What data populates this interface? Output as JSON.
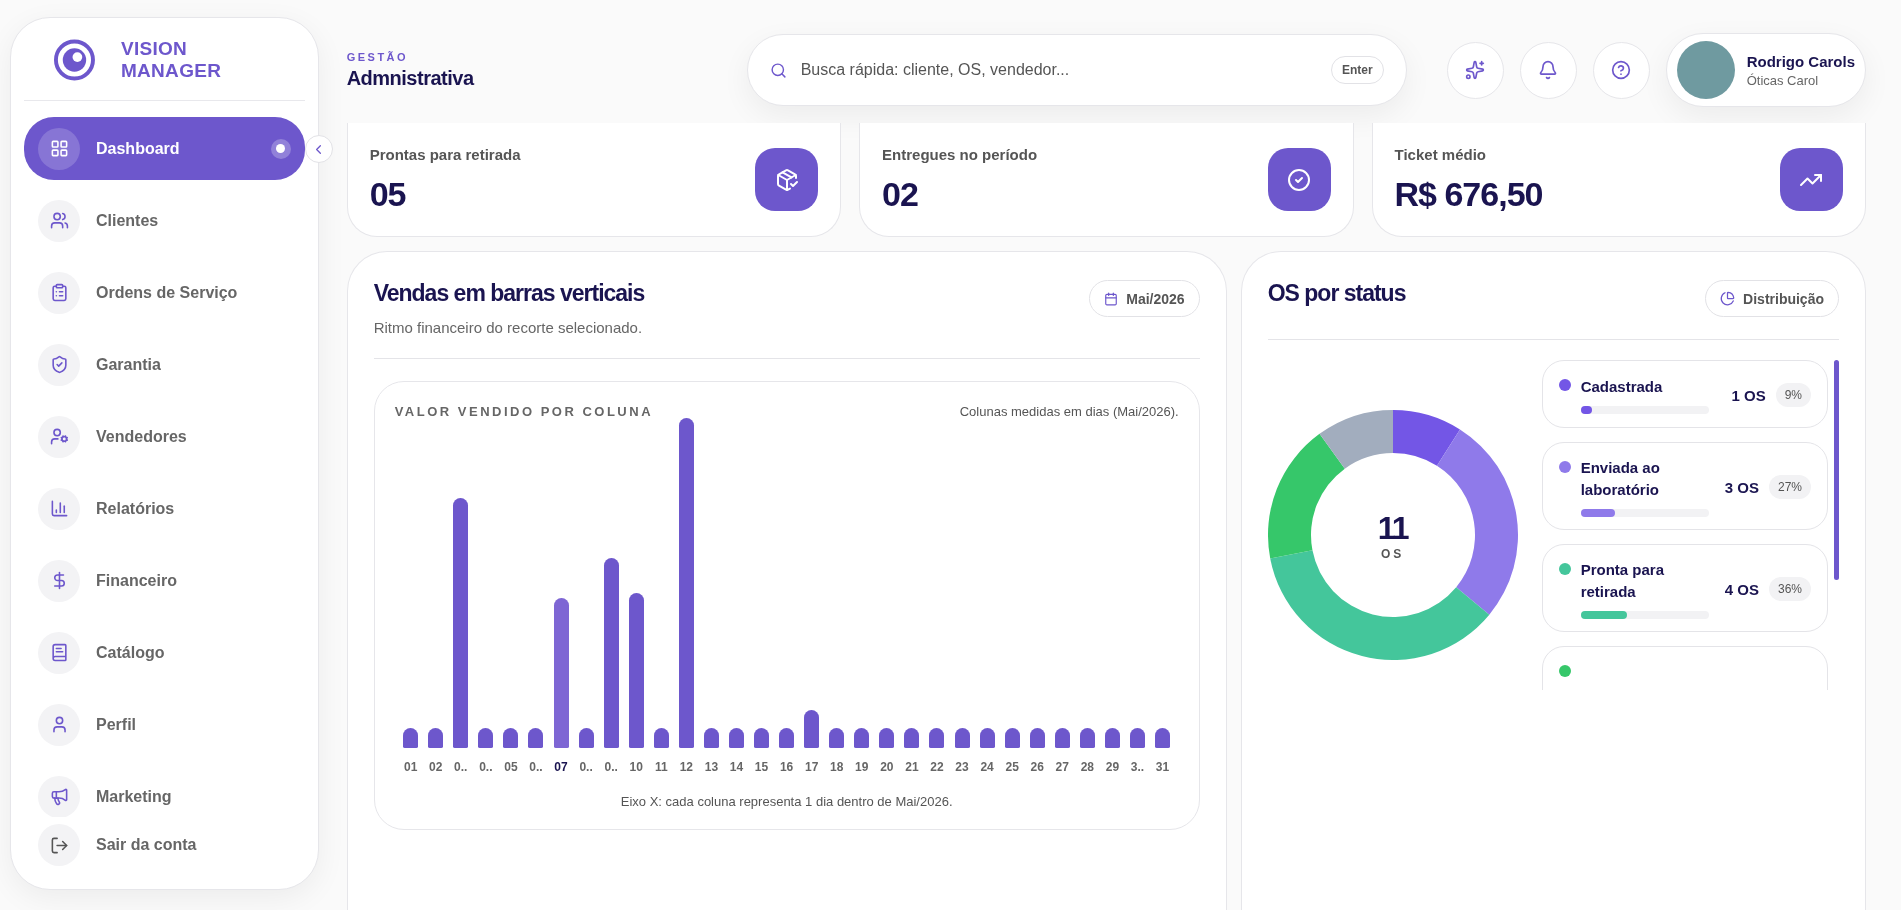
{
  "sidebar": {
    "brand": "VISION MANAGER",
    "items": [
      {
        "label": "Dashboard",
        "selected": true
      },
      {
        "label": "Clientes",
        "selected": false
      },
      {
        "label": "Ordens de Serviço",
        "selected": false
      },
      {
        "label": "Garantia",
        "selected": false
      },
      {
        "label": "Vendedores",
        "selected": false
      },
      {
        "label": "Relatórios",
        "selected": false
      },
      {
        "label": "Financeiro",
        "selected": false
      },
      {
        "label": "Catálogo",
        "selected": false
      },
      {
        "label": "Perfil",
        "selected": false
      },
      {
        "label": "Marketing",
        "selected": false
      }
    ],
    "logout": "Sair da conta"
  },
  "header": {
    "eyebrow": "GESTÃO",
    "title": "Admnistrativa",
    "search": {
      "placeholder": "Busca rápida: cliente, OS, vendedor...",
      "key": "Enter"
    },
    "user": {
      "name": "Rodrigo Carols",
      "company": "Óticas Carol"
    }
  },
  "stats": [
    {
      "label": "Prontas para retirada",
      "value": "05"
    },
    {
      "label": "Entregues no período",
      "value": "02"
    },
    {
      "label": "Ticket médio",
      "value": "R$ 676,50"
    }
  ],
  "sales": {
    "title": "Vendas em barras verticais",
    "subtitle": "Ritmo financeiro do recorte selecionado.",
    "period": "Mai/2026",
    "chart_title": "VALOR VENDIDO POR COLUNA",
    "chart_note": "Colunas medidas em dias (Mai/2026).",
    "columns": [
      {
        "label": "01",
        "selected": false
      },
      {
        "label": "02",
        "selected": false
      },
      {
        "label": "0..",
        "selected": false
      },
      {
        "label": "0..",
        "selected": false
      },
      {
        "label": "05",
        "selected": false
      },
      {
        "label": "0..",
        "selected": false
      },
      {
        "label": "07",
        "selected": true
      },
      {
        "label": "0..",
        "selected": false
      },
      {
        "label": "0..",
        "selected": false
      },
      {
        "label": "10",
        "selected": false
      },
      {
        "label": "11",
        "selected": false
      },
      {
        "label": "12",
        "selected": false
      },
      {
        "label": "13",
        "selected": false
      },
      {
        "label": "14",
        "selected": false
      },
      {
        "label": "15",
        "selected": false
      },
      {
        "label": "16",
        "selected": false
      },
      {
        "label": "17",
        "selected": false
      },
      {
        "label": "18",
        "selected": false
      },
      {
        "label": "19",
        "selected": false
      },
      {
        "label": "20",
        "selected": false
      },
      {
        "label": "21",
        "selected": false
      },
      {
        "label": "22",
        "selected": false
      },
      {
        "label": "23",
        "selected": false
      },
      {
        "label": "24",
        "selected": false
      },
      {
        "label": "25",
        "selected": false
      },
      {
        "label": "26",
        "selected": false
      },
      {
        "label": "27",
        "selected": false
      },
      {
        "label": "28",
        "selected": false
      },
      {
        "label": "29",
        "selected": false
      },
      {
        "label": "3..",
        "selected": false
      },
      {
        "label": "31",
        "selected": false
      }
    ],
    "axis_note": "Eixo X: cada coluna representa 1 dia dentro de Mai/2026."
  },
  "status": {
    "title": "OS por status",
    "button": "Distribuição",
    "total": "11",
    "total_unit": "OS",
    "chart_data": {
      "type": "donut",
      "values": [
        9,
        27,
        36,
        18,
        10
      ]
    },
    "items": [
      {
        "name": "Cadastrada",
        "count": "1 OS",
        "percent": "9%",
        "color": "#7356e6",
        "level": 0.09
      },
      {
        "name": "Enviada ao laboratório",
        "count": "3 OS",
        "percent": "27%",
        "color": "#8f7aea",
        "level": 0.27
      },
      {
        "name": "Pronta para retirada",
        "count": "4 OS",
        "percent": "36%",
        "color": "#44c69b",
        "level": 0.36
      },
      {
        "color": "#36c76a"
      }
    ]
  }
}
